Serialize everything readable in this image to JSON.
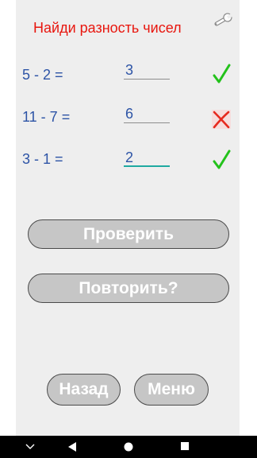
{
  "header": {
    "title": "Найди разность чисел",
    "settings_icon": "wrench-icon"
  },
  "problems": [
    {
      "expression": "5 - 2 =",
      "answer": "3",
      "result": "correct",
      "result_icon": "checkmark-icon"
    },
    {
      "expression": "11 - 7 =",
      "answer": "6",
      "result": "wrong",
      "result_icon": "cross-icon"
    },
    {
      "expression": "3 - 1 =",
      "answer": "2",
      "result": "correct",
      "result_icon": "checkmark-icon"
    }
  ],
  "actions": {
    "check_label": "Проверить",
    "repeat_label": "Повторить?",
    "back_label": "Назад",
    "menu_label": "Меню"
  },
  "colors": {
    "title": "#e8160e",
    "text": "#2d54a6",
    "correct": "#23c21b",
    "wrong": "#e62a1f",
    "button_bg": "#c6c6c6",
    "accent_underline": "#1fa9a1"
  },
  "system_nav": {
    "items": [
      "chevron-down-icon",
      "back-icon",
      "home-icon",
      "recents-icon"
    ]
  }
}
